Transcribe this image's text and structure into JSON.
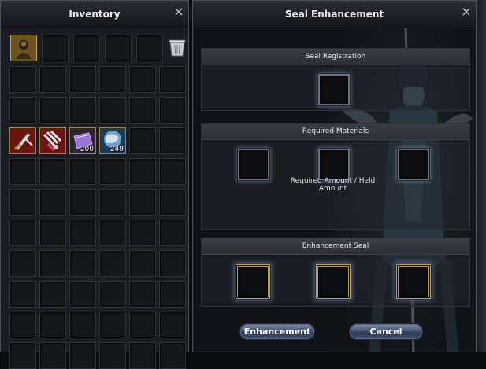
{
  "inventory": {
    "title": "Inventory",
    "close_glyph": "×",
    "item_quantities": {
      "purple_material": "200",
      "crystal_material": "249"
    }
  },
  "seal_enhancement": {
    "title": "Seal Enhancement",
    "close_glyph": "×",
    "sections": {
      "registration": "Seal Registration",
      "materials": "Required Materials",
      "enhancement": "Enhancement Seal"
    },
    "amount_label": "Required Amount / Held Amount",
    "buttons": {
      "enhance": "Enhancement",
      "cancel": "Cancel"
    }
  },
  "icons": [
    "character-portrait-icon",
    "trash-icon",
    "sword-icon",
    "claw-icon",
    "purple-material-icon",
    "crystal-material-icon",
    "close-icon"
  ],
  "colors": {
    "button_blue": "#4a5878",
    "slot_glow": "#8296c8",
    "gold_frame": "#b59d6a"
  }
}
